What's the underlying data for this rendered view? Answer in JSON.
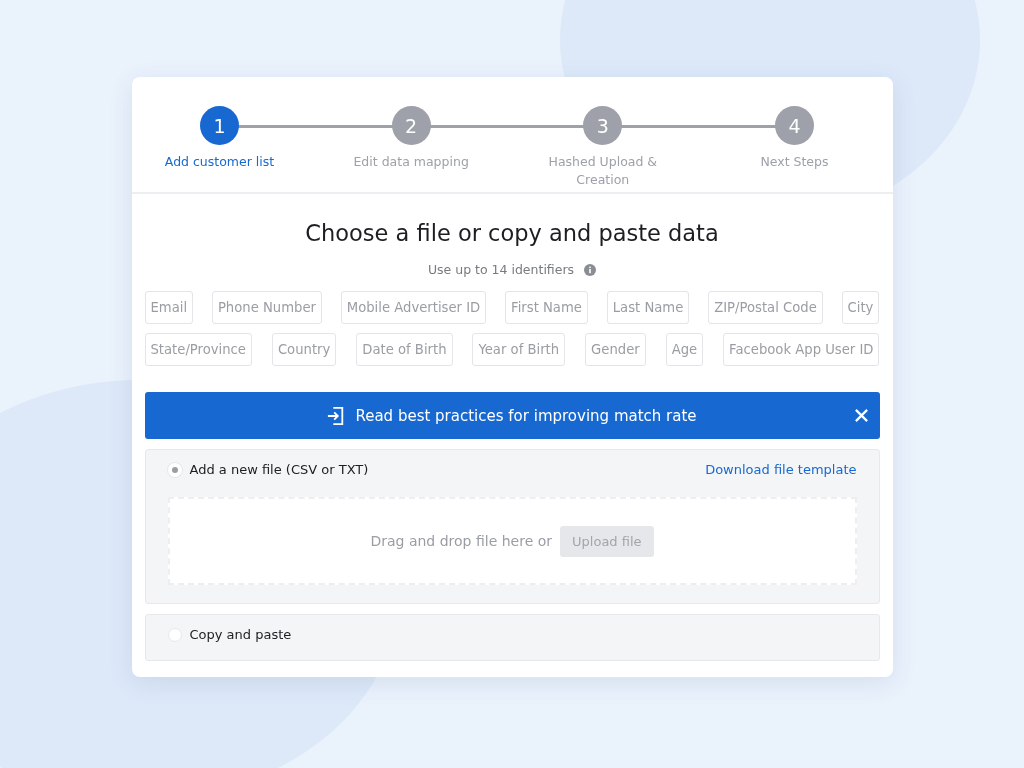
{
  "steps": [
    {
      "number": "1",
      "label": "Add customer list",
      "selected": true
    },
    {
      "number": "2",
      "label": "Edit data mapping",
      "selected": false
    },
    {
      "number": "3",
      "label": "Hashed Upload & Creation",
      "selected": false
    },
    {
      "number": "4",
      "label": "Next Steps",
      "selected": false
    }
  ],
  "heading": "Choose a file or copy and paste data",
  "subheading": "Use up to 14 identifiers",
  "identifier_rows": [
    [
      "Email",
      "Phone Number",
      "Mobile Advertiser ID",
      "First Name",
      "Last Name",
      "ZIP/Postal Code",
      "City"
    ],
    [
      "State/Province",
      "Country",
      "Date of Birth",
      "Year of Birth",
      "Gender",
      "Age",
      "Facebook App User ID"
    ]
  ],
  "banner": {
    "text": "Read best practices for improving match rate"
  },
  "options": [
    {
      "kind": "file",
      "label": "Add a new file (CSV or TXT)",
      "selected": true,
      "link": "Download file template",
      "dropzone_text": "Drag and drop file here or",
      "upload_button": "Upload file"
    },
    {
      "kind": "paste",
      "label": "Copy and paste",
      "selected": false
    }
  ]
}
